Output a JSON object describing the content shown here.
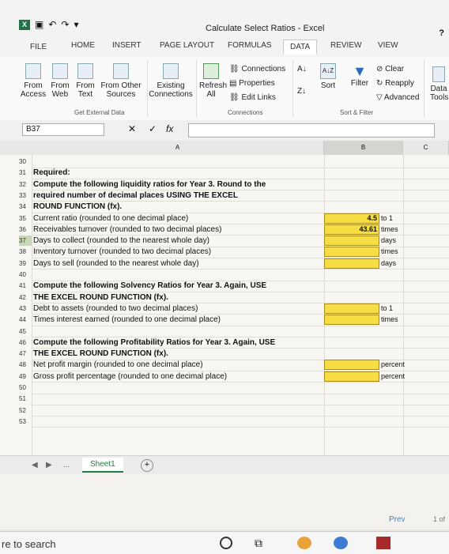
{
  "app": {
    "title": "Calculate Select Ratios - Excel",
    "help": "?"
  },
  "ribbon_tabs": [
    "FILE",
    "HOME",
    "INSERT",
    "PAGE LAYOUT",
    "FORMULAS",
    "DATA",
    "REVIEW",
    "VIEW"
  ],
  "active_tab": "DATA",
  "ribbon": {
    "from_access": "From Access",
    "from_web": "From Web",
    "from_text": "From Text",
    "from_other": "From Other Sources",
    "existing": "Existing Connections",
    "get_external": "Get External Data",
    "refresh": "Refresh All",
    "connections": "Connections",
    "properties": "Properties",
    "edit_links": "Edit Links",
    "connections_group": "Connections",
    "sort": "Sort",
    "filter": "Filter",
    "clear": "Clear",
    "reapply": "Reapply",
    "advanced": "Advanced",
    "sort_filter_group": "Sort & Filter",
    "data_tools": "Data Tools",
    "az": "A↓Z"
  },
  "formula_bar": {
    "name_box": "B37",
    "fx": "fx",
    "cancel": "✕",
    "enter": "✓"
  },
  "columns": [
    "A",
    "B",
    "C"
  ],
  "rows": [
    {
      "n": "30",
      "text": "",
      "bold": false
    },
    {
      "n": "31",
      "text": "Required:",
      "bold": true
    },
    {
      "n": "32",
      "text": "Compute the following liquidity ratios for Year 3. Round to the",
      "bold": true
    },
    {
      "n": "33",
      "text": "required number of decimal places USING THE EXCEL",
      "bold": true
    },
    {
      "n": "34",
      "text": "ROUND FUNCTION (fx).",
      "bold": true
    },
    {
      "n": "35",
      "text": "Current ratio (rounded to one decimal place)",
      "bold": false
    },
    {
      "n": "36",
      "text": "Receivables turnover (rounded to two decimal places)",
      "bold": false
    },
    {
      "n": "37",
      "text": "Days to collect (rounded to the nearest whole day)",
      "bold": false
    },
    {
      "n": "38",
      "text": "Inventory turnover (rounded to two decimal places)",
      "bold": false
    },
    {
      "n": "39",
      "text": "Days to sell (rounded to the nearest whole day)",
      "bold": false
    },
    {
      "n": "40",
      "text": "",
      "bold": false
    },
    {
      "n": "41",
      "text": "Compute the following Solvency Ratios for Year 3. Again, USE",
      "bold": true
    },
    {
      "n": "42",
      "text": "THE EXCEL ROUND FUNCTION (fx).",
      "bold": true
    },
    {
      "n": "43",
      "text": "Debt to assets (rounded to two decimal places)",
      "bold": false
    },
    {
      "n": "44",
      "text": "Times interest earned (rounded to one decimal place)",
      "bold": false
    },
    {
      "n": "45",
      "text": "",
      "bold": false
    },
    {
      "n": "46",
      "text": "Compute the following Profitability Ratios for Year 3. Again, USE",
      "bold": true
    },
    {
      "n": "47",
      "text": "THE EXCEL ROUND FUNCTION (fx).",
      "bold": true
    },
    {
      "n": "48",
      "text": "Net profit margin (rounded to one decimal place)",
      "bold": false
    },
    {
      "n": "49",
      "text": "Gross profit percentage (rounded to one decimal place)",
      "bold": false
    },
    {
      "n": "50",
      "text": "",
      "bold": false
    },
    {
      "n": "51",
      "text": "",
      "bold": false
    },
    {
      "n": "52",
      "text": "",
      "bold": false
    },
    {
      "n": "53",
      "text": "",
      "bold": false
    }
  ],
  "cells": {
    "r35": {
      "value": "4.5",
      "unit": "to 1"
    },
    "r36": {
      "value": "43.61",
      "unit": "times"
    },
    "r37": {
      "value": "",
      "unit": "days"
    },
    "r38": {
      "value": "",
      "unit": "times"
    },
    "r39": {
      "value": "",
      "unit": "days"
    },
    "r43": {
      "value": "",
      "unit": "to 1"
    },
    "r44": {
      "value": "",
      "unit": "times"
    },
    "r48": {
      "value": "",
      "unit": "percent"
    },
    "r49": {
      "value": "",
      "unit": "percent"
    }
  },
  "sheet_tab": "Sheet1",
  "sheet_nav": "...",
  "pager": {
    "prev": "Prev",
    "count": "1 of"
  },
  "taskbar": {
    "search": "re to search"
  },
  "colors": {
    "excel_green": "#217346",
    "input_yellow": "#f5dd43"
  }
}
